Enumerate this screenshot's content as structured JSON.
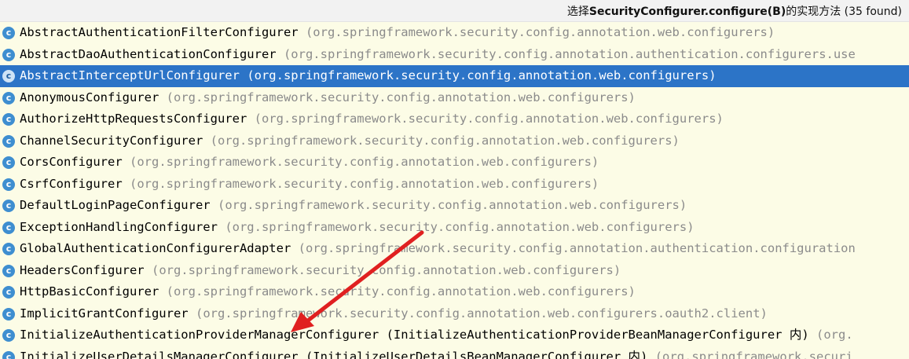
{
  "header": {
    "prefix": "选择",
    "bold": "SecurityConfigurer.configure(B)",
    "suffix": "的实现方法 (35 found)"
  },
  "items": [
    {
      "name": "AbstractAuthenticationFilterConfigurer",
      "pkg": "(org.springframework.security.config.annotation.web.configurers)",
      "selected": false
    },
    {
      "name": "AbstractDaoAuthenticationConfigurer",
      "pkg": "(org.springframework.security.config.annotation.authentication.configurers.use",
      "selected": false
    },
    {
      "name": "AbstractInterceptUrlConfigurer",
      "pkg": "(org.springframework.security.config.annotation.web.configurers)",
      "selected": true
    },
    {
      "name": "AnonymousConfigurer",
      "pkg": "(org.springframework.security.config.annotation.web.configurers)",
      "selected": false
    },
    {
      "name": "AuthorizeHttpRequestsConfigurer",
      "pkg": "(org.springframework.security.config.annotation.web.configurers)",
      "selected": false
    },
    {
      "name": "ChannelSecurityConfigurer",
      "pkg": "(org.springframework.security.config.annotation.web.configurers)",
      "selected": false
    },
    {
      "name": "CorsConfigurer",
      "pkg": "(org.springframework.security.config.annotation.web.configurers)",
      "selected": false
    },
    {
      "name": "CsrfConfigurer",
      "pkg": "(org.springframework.security.config.annotation.web.configurers)",
      "selected": false
    },
    {
      "name": "DefaultLoginPageConfigurer",
      "pkg": "(org.springframework.security.config.annotation.web.configurers)",
      "selected": false
    },
    {
      "name": "ExceptionHandlingConfigurer",
      "pkg": "(org.springframework.security.config.annotation.web.configurers)",
      "selected": false
    },
    {
      "name": "GlobalAuthenticationConfigurerAdapter",
      "pkg": "(org.springframework.security.config.annotation.authentication.configuration",
      "selected": false
    },
    {
      "name": "HeadersConfigurer",
      "pkg": "(org.springframework.security.config.annotation.web.configurers)",
      "selected": false
    },
    {
      "name": "HttpBasicConfigurer",
      "pkg": "(org.springframework.security.config.annotation.web.configurers)",
      "selected": false
    },
    {
      "name": "ImplicitGrantConfigurer",
      "pkg": "(org.springframework.security.config.annotation.web.configurers.oauth2.client)",
      "selected": false
    },
    {
      "name": "InitializeAuthenticationProviderManagerConfigurer (InitializeAuthenticationProviderBeanManagerConfigurer 内)",
      "pkg": "(org.",
      "selected": false
    },
    {
      "name": "InitializeUserDetailsManagerConfigurer (InitializeUserDetailsBeanManagerConfigurer 内)",
      "pkg": "(org.springframework.securi",
      "selected": false
    }
  ],
  "icon_letter": "c",
  "colors": {
    "selected_bg": "#2c74c7",
    "package_text": "#8b8b8b",
    "annotation_arrow": "#e02020"
  }
}
